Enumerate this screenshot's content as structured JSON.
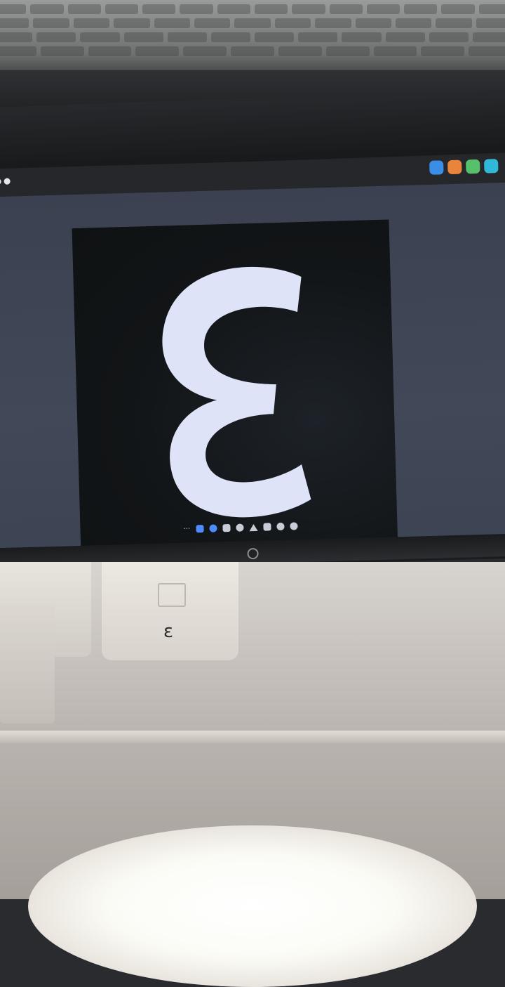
{
  "screen": {
    "image_glyph": "ɛ",
    "image_glyph_color": "#dfe3f7",
    "image_background": "#111416",
    "desktop_background": "#3f4555"
  },
  "taskbar": {
    "icons": [
      "more-icon",
      "image-viewer-icon",
      "chat-icon",
      "email-icon",
      "settings-icon",
      "triangle-icon",
      "document-icon",
      "sync-icon",
      "gear-icon"
    ]
  },
  "tray": {
    "icons": [
      "blue-app-icon",
      "browser-icon",
      "green-app-icon",
      "teal-app-icon"
    ]
  },
  "desk": {
    "holder_glyph": "ɛ"
  }
}
